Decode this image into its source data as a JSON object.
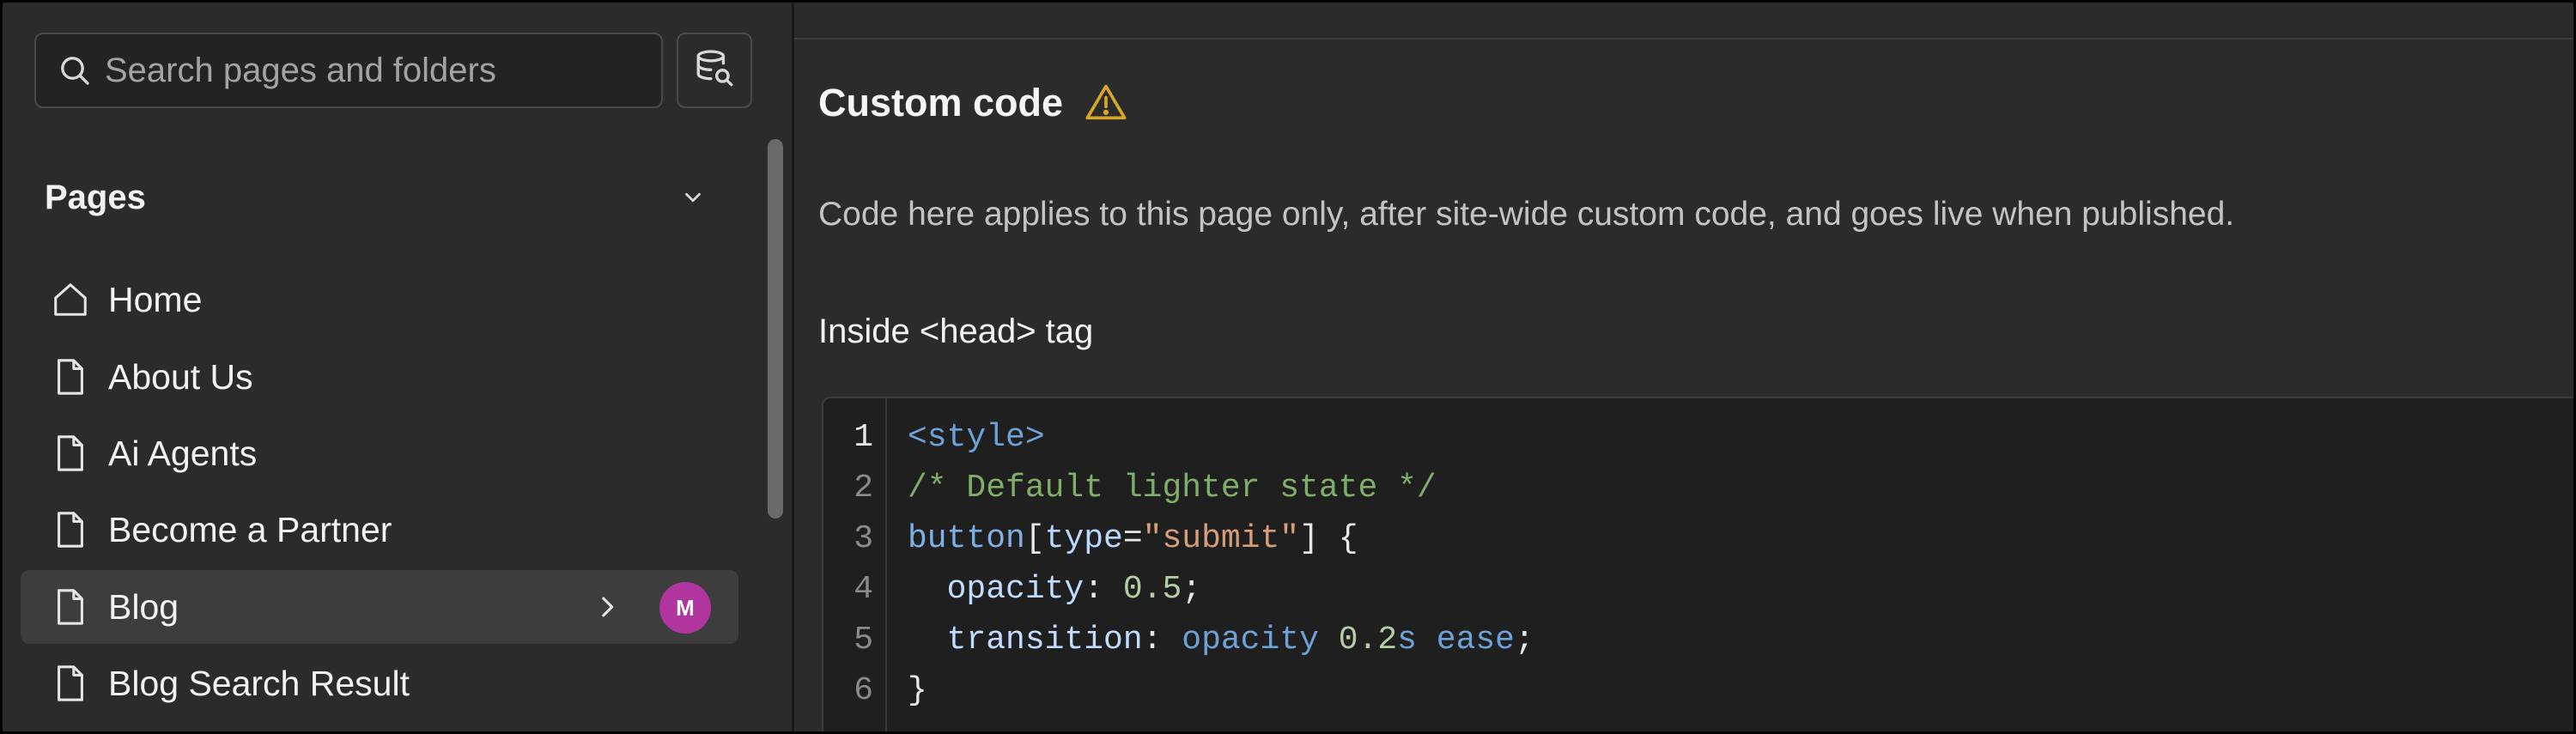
{
  "sidebar": {
    "search": {
      "placeholder": "Search pages and folders",
      "value": ""
    },
    "pages_title": "Pages",
    "items": [
      {
        "label": "Home",
        "icon": "home-icon"
      },
      {
        "label": "About Us",
        "icon": "page-icon"
      },
      {
        "label": "Ai Agents",
        "icon": "page-icon"
      },
      {
        "label": "Become a Partner",
        "icon": "page-icon"
      },
      {
        "label": "Blog",
        "icon": "page-icon",
        "selected": true,
        "avatar": "M"
      },
      {
        "label": "Blog Search Result",
        "icon": "page-icon"
      }
    ]
  },
  "main": {
    "section_title": "Custom code",
    "description": "Code here applies to this page only, after site-wide custom code, and goes live when published.",
    "head_label": "Inside <head> tag",
    "code": {
      "line_numbers": [
        "1",
        "2",
        "3",
        "4",
        "5",
        "6"
      ],
      "lines": [
        "<style>",
        "/* Default lighter state */",
        "button[type=\"submit\"] {",
        "  opacity: 0.5;",
        "  transition: opacity 0.2s ease;",
        "}"
      ],
      "tokens": {
        "l3_sel": "button",
        "l3_b1": "[",
        "l3_attr": "type",
        "l3_eq": "=",
        "l3_str": "\"submit\"",
        "l3_b2": "] {",
        "l4_indent": "  ",
        "l4_prop": "opacity",
        "l4_colon": ": ",
        "l4_num": "0.5",
        "l4_semi": ";",
        "l5_indent": "  ",
        "l5_prop": "transition",
        "l5_colon": ": ",
        "l5_kw1": "opacity",
        "l5_sp": " ",
        "l5_num": "0.2",
        "l5_unit": "s",
        "l5_sp2": " ",
        "l5_kw2": "ease",
        "l5_semi": ";"
      }
    }
  },
  "colors": {
    "background": "#2b2b2b",
    "code_background": "#1f1f1f",
    "avatar": "#b0359f",
    "warning": "#d9a726"
  }
}
